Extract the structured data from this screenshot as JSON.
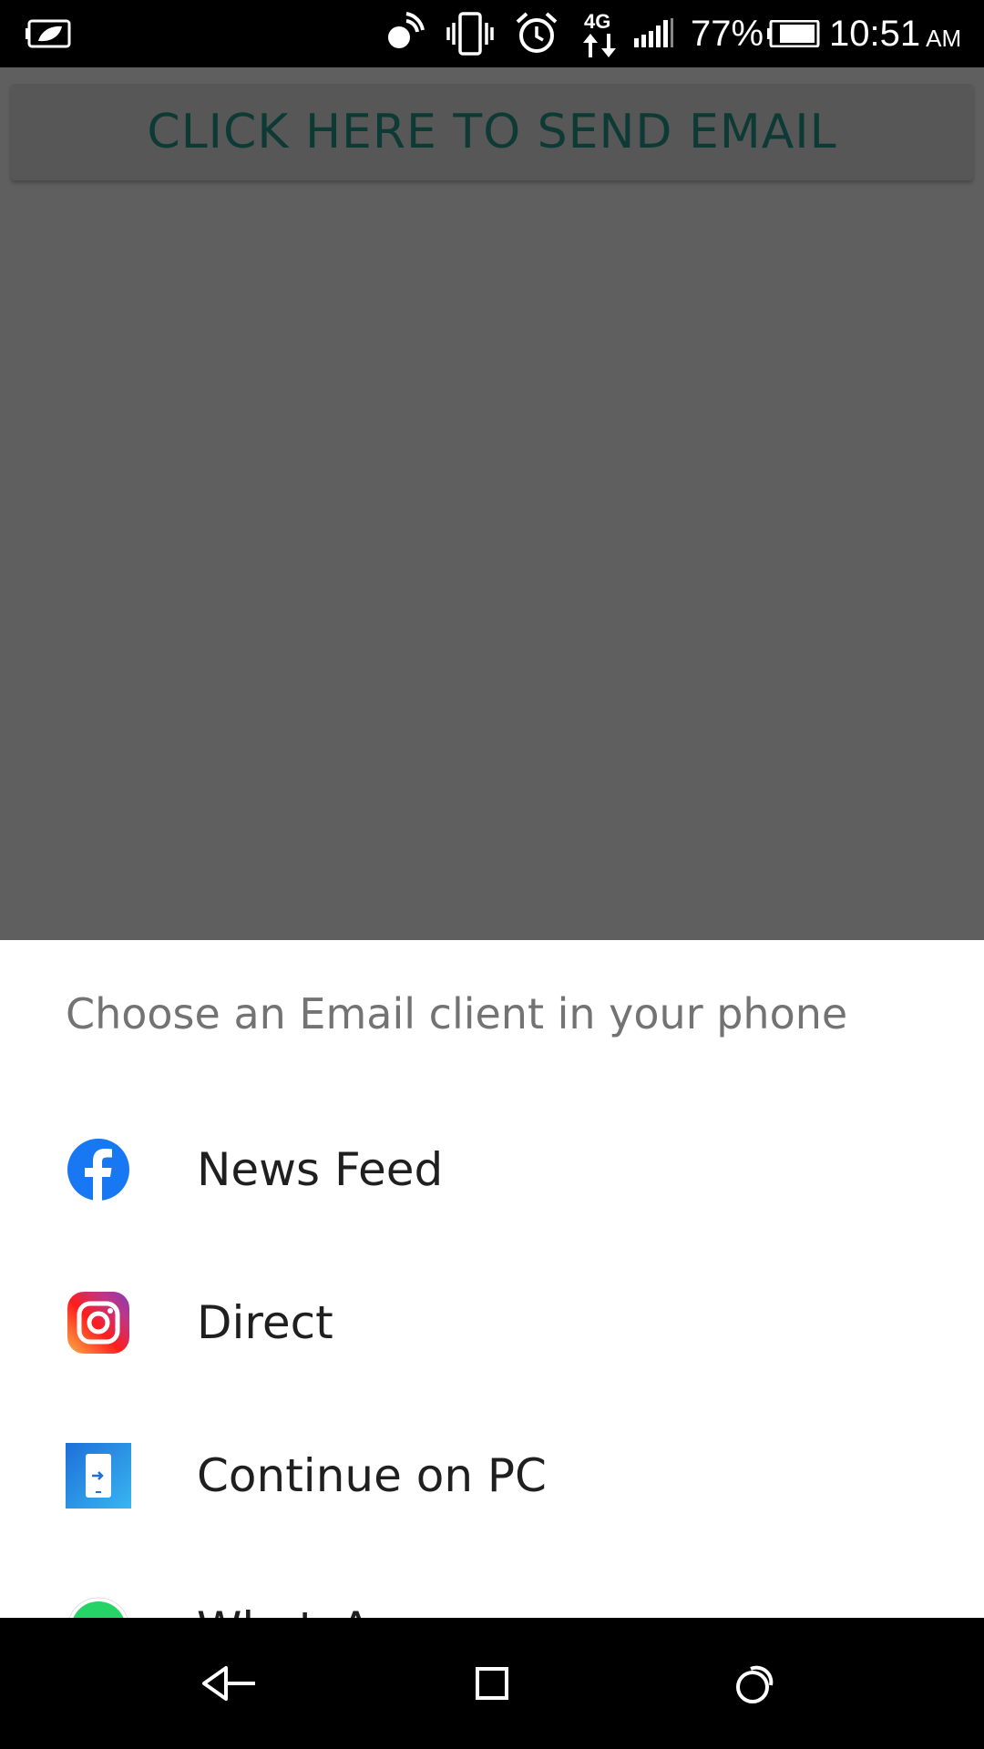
{
  "status_bar": {
    "battery_percent": "77%",
    "time": "10:51",
    "ampm": "AM",
    "network": "4G",
    "icons": [
      "battery-saver-icon",
      "nfc-icon",
      "vibrate-icon",
      "alarm-icon",
      "4g-data-icon",
      "signal-icon",
      "battery-icon"
    ]
  },
  "app": {
    "send_button_label": "CLICK HERE TO SEND EMAIL"
  },
  "chooser": {
    "title": "Choose an Email client in your phone",
    "items": [
      {
        "label": "News Feed",
        "icon": "facebook-icon"
      },
      {
        "label": "Direct",
        "icon": "instagram-icon"
      },
      {
        "label": "Continue on PC",
        "icon": "continue-on-pc-icon"
      },
      {
        "label": "WhatsApp",
        "icon": "whatsapp-icon"
      }
    ]
  },
  "nav_bar": {
    "buttons": [
      "back-icon",
      "home-icon",
      "recents-icon"
    ]
  },
  "colors": {
    "facebook": "#1877f2",
    "whatsapp": "#25d366",
    "button_text": "#0e3a35"
  }
}
